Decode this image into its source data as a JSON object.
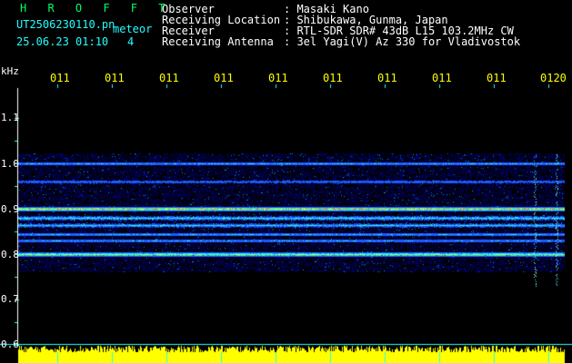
{
  "app": {
    "title": "H R O F F T",
    "filename": "UT2506230110.pn",
    "type_label": "meteor",
    "datetime": "25.06.23 01:10",
    "count": "4"
  },
  "header": {
    "labels": [
      "Observer",
      "Receiving Location",
      "Receiver",
      "Receiving Antenna"
    ],
    "values": [
      ": Masaki Kano",
      ": Shibukawa, Gunma, Japan",
      ": RTL-SDR SDR# 43dB L15 103.2MHz CW",
      ": 3el Yagi(V) Az 330 for Vladivostok"
    ]
  },
  "axes": {
    "unit": "kHz",
    "time_ticks": [
      "011",
      "011",
      "011",
      "011",
      "011",
      "011",
      "011",
      "011",
      "011",
      "0120"
    ],
    "freq_ticks": [
      "1.1",
      "1.0",
      "0.9",
      "0.8",
      "0.7",
      "0.6"
    ]
  },
  "colors": {
    "header_text": "#ffffff",
    "title": "#00ff66",
    "tick_text": "#ffff00",
    "grid": "#22ffff",
    "histogram": "#ffff00"
  },
  "chart_data": {
    "type": "heatmap",
    "x_unit": "time (minutes, 01:10–01:20)",
    "y_unit": "kHz",
    "ylim": [
      0.6,
      1.1
    ],
    "signal_lines_khz": [
      {
        "freq": 1.0,
        "strength": 0.45
      },
      {
        "freq": 0.96,
        "strength": 0.35
      },
      {
        "freq": 0.9,
        "strength": 1.0
      },
      {
        "freq": 0.88,
        "strength": 0.6
      },
      {
        "freq": 0.865,
        "strength": 0.55
      },
      {
        "freq": 0.845,
        "strength": 0.45
      },
      {
        "freq": 0.83,
        "strength": 0.4
      },
      {
        "freq": 0.8,
        "strength": 0.85
      }
    ],
    "meteor_events_minute": [
      8.9,
      9.3
    ]
  }
}
